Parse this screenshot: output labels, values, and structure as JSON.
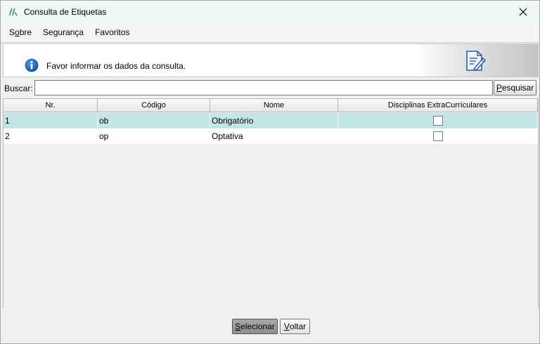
{
  "window": {
    "title": "Consulta de Etiquetas",
    "close_symbol": "✕"
  },
  "menu": [
    {
      "label": "Sobre",
      "mnemonic_index": 1
    },
    {
      "label": "Segurança"
    },
    {
      "label": "Favoritos"
    }
  ],
  "banner": {
    "message": "Favor informar os dados da consulta.",
    "info_icon": "info-icon",
    "doc_icon": "document-edit-icon"
  },
  "search": {
    "label": "Buscar:",
    "value": "",
    "button_label": "Pesquisar"
  },
  "table": {
    "columns": [
      "Nr.",
      "Código",
      "Nome",
      "Disciplinas ExtraCurrículares"
    ],
    "rows": [
      {
        "nr": "1",
        "codigo": "ob",
        "nome": "Obrigatório",
        "extra": false,
        "selected": true
      },
      {
        "nr": "2",
        "codigo": "op",
        "nome": "Optativa",
        "extra": false,
        "selected": false
      }
    ]
  },
  "footer": {
    "select_label": "Selecionar",
    "back_label": "Voltar"
  },
  "colors": {
    "selected_row": "#c4e6e6",
    "title_bar": "#f0f8f7",
    "info_blue": "#1a5fb4"
  }
}
